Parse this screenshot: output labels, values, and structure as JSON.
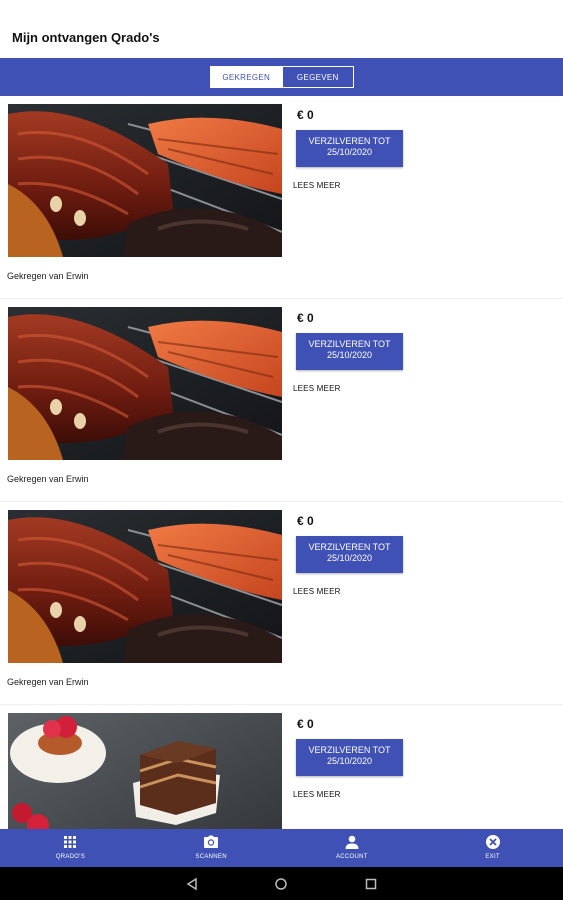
{
  "header": {
    "title": "Mijn ontvangen Qrado's"
  },
  "segments": {
    "received": "GEKREGEN",
    "given": "GEGEVEN"
  },
  "cards": [
    {
      "amount": "€ 0",
      "redeem_line1": "VERZILVEREN TOT",
      "redeem_line2": "25/10/2020",
      "read_more": "LEES MEER",
      "from": "Gekregen van Erwin",
      "image": "ribs-photo"
    },
    {
      "amount": "€ 0",
      "redeem_line1": "VERZILVEREN TOT",
      "redeem_line2": "25/10/2020",
      "read_more": "LEES MEER",
      "from": "Gekregen van Erwin",
      "image": "ribs-photo"
    },
    {
      "amount": "€ 0",
      "redeem_line1": "VERZILVEREN TOT",
      "redeem_line2": "25/10/2020",
      "read_more": "LEES MEER",
      "from": "Gekregen van Erwin",
      "image": "ribs-photo"
    },
    {
      "amount": "€ 0",
      "redeem_line1": "VERZILVEREN TOT",
      "redeem_line2": "25/10/2020",
      "read_more": "LEES MEER",
      "from": "",
      "image": "dessert-photo"
    }
  ],
  "tabbar": [
    {
      "label": "QRADO'S",
      "icon": "grid-icon"
    },
    {
      "label": "SCANNEN",
      "icon": "camera-icon"
    },
    {
      "label": "ACCOUNT",
      "icon": "person-icon"
    },
    {
      "label": "EXIT",
      "icon": "close-circle-icon"
    }
  ],
  "colors": {
    "primary": "#3f51b5",
    "background": "#ffffff",
    "system_bar": "#000000"
  }
}
